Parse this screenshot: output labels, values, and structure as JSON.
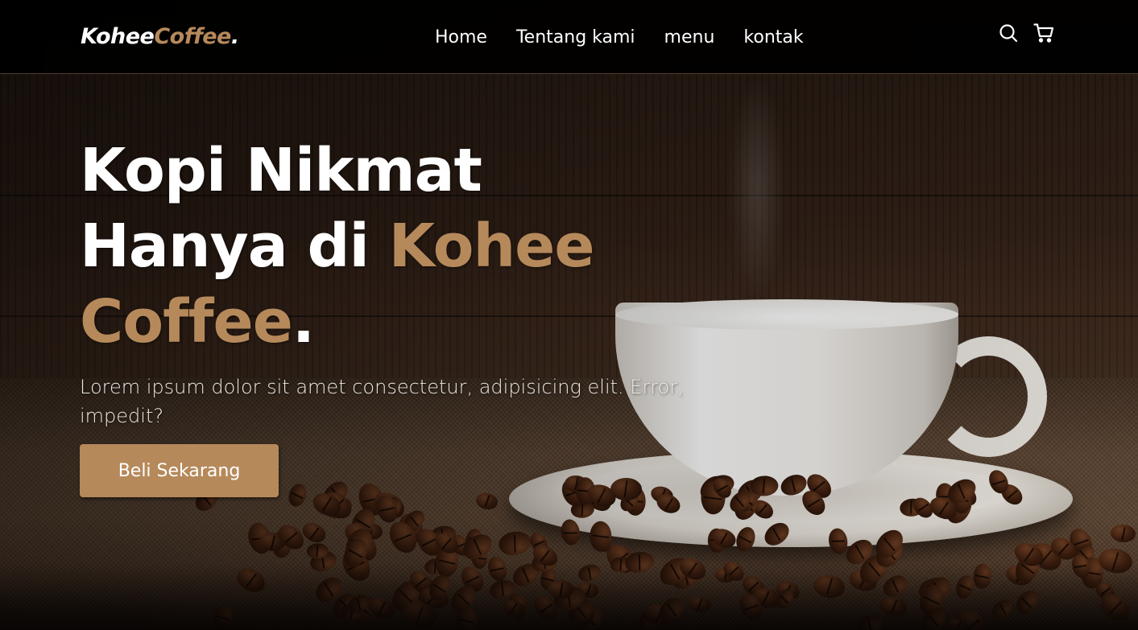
{
  "brand": {
    "name_part1": "Kohee",
    "name_part2": "Coffee",
    "dot": "."
  },
  "nav": {
    "links": [
      {
        "label": "Home"
      },
      {
        "label": "Tentang kami"
      },
      {
        "label": "menu"
      },
      {
        "label": "kontak"
      }
    ],
    "icons": [
      "search-icon",
      "shopping-cart-icon"
    ]
  },
  "hero": {
    "title_line1": "Kopi Nikmat",
    "title_line2_plain": "Hanya di ",
    "title_line2_accent": "Kohee",
    "title_line3_accent": "Coffee",
    "title_dot": ".",
    "description": "Lorem ipsum dolor sit amet consectetur, adipisicing elit. Error, impedit?",
    "cta_label": "Beli Sekarang"
  },
  "colors": {
    "accent": "#b6895b",
    "navbar_bg": "#000000",
    "text": "#ffffff"
  }
}
